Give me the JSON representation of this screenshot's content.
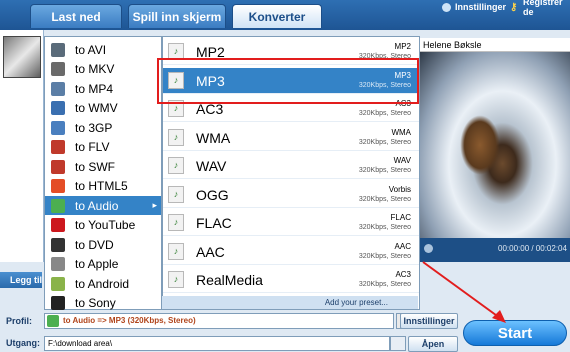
{
  "tabs": [
    "Last ned",
    "Spill inn skjerm",
    "Konverter"
  ],
  "header": {
    "settings": "Innstillinger",
    "register": "Registrer de"
  },
  "filename": "Helene Bøksle",
  "player": {
    "time": "00:00:00 / 00:02:04"
  },
  "menu": [
    {
      "label": "to AVI",
      "icon": "avi",
      "color": "#5a6b7a"
    },
    {
      "label": "to MKV",
      "icon": "mkv",
      "color": "#6a6a6a"
    },
    {
      "label": "to MP4",
      "icon": "mp4",
      "color": "#5b7ea6"
    },
    {
      "label": "to WMV",
      "icon": "wmv",
      "color": "#3a6fb0"
    },
    {
      "label": "to 3GP",
      "icon": "3gp",
      "color": "#4a7fbf"
    },
    {
      "label": "to FLV",
      "icon": "flv",
      "color": "#c0392b"
    },
    {
      "label": "to SWF",
      "icon": "swf",
      "color": "#c0392b"
    },
    {
      "label": "to HTML5",
      "icon": "html5",
      "color": "#e44d26"
    },
    {
      "label": "to Audio",
      "icon": "audio",
      "color": "#4caf50"
    },
    {
      "label": "to YouTube",
      "icon": "youtube",
      "color": "#cc181e"
    },
    {
      "label": "to DVD",
      "icon": "dvd",
      "color": "#333333"
    },
    {
      "label": "to Apple",
      "icon": "apple",
      "color": "#888888"
    },
    {
      "label": "to Android",
      "icon": "android",
      "color": "#8ab34a"
    },
    {
      "label": "to Sony",
      "icon": "sony",
      "color": "#222222"
    }
  ],
  "selected_menu": 8,
  "audio_formats": [
    {
      "name": "MP2",
      "fmt": "MP2",
      "detail": "320Kbps, Stereo"
    },
    {
      "name": "MP3",
      "fmt": "MP3",
      "detail": "320Kbps, Stereo"
    },
    {
      "name": "AC3",
      "fmt": "AC3",
      "detail": "320Kbps, Stereo"
    },
    {
      "name": "WMA",
      "fmt": "WMA",
      "detail": "320Kbps, Stereo"
    },
    {
      "name": "WAV",
      "fmt": "WAV",
      "detail": "320Kbps, Stereo"
    },
    {
      "name": "OGG",
      "fmt": "Vorbis",
      "detail": "320Kbps, Stereo"
    },
    {
      "name": "FLAC",
      "fmt": "FLAC",
      "detail": "320Kbps, Stereo"
    },
    {
      "name": "AAC",
      "fmt": "AAC",
      "detail": "320Kbps, Stereo"
    },
    {
      "name": "RealMedia",
      "fmt": "AC3",
      "detail": "320Kbps, Stereo"
    }
  ],
  "selected_format": 1,
  "add_preset": "Add your preset...",
  "bottom": {
    "add_label": "Legg til",
    "profile_label": "Profil:",
    "profile_value": "to Audio => MP3 (320Kbps, Stereo)",
    "settings_button": "Innstillinger",
    "output_label": "Utgang:",
    "output_value": "F:\\download area\\",
    "open_button": "Åpen",
    "start_button": "Start"
  },
  "colors": {
    "accent": "#3483c7",
    "highlight": "#e21d1d"
  }
}
